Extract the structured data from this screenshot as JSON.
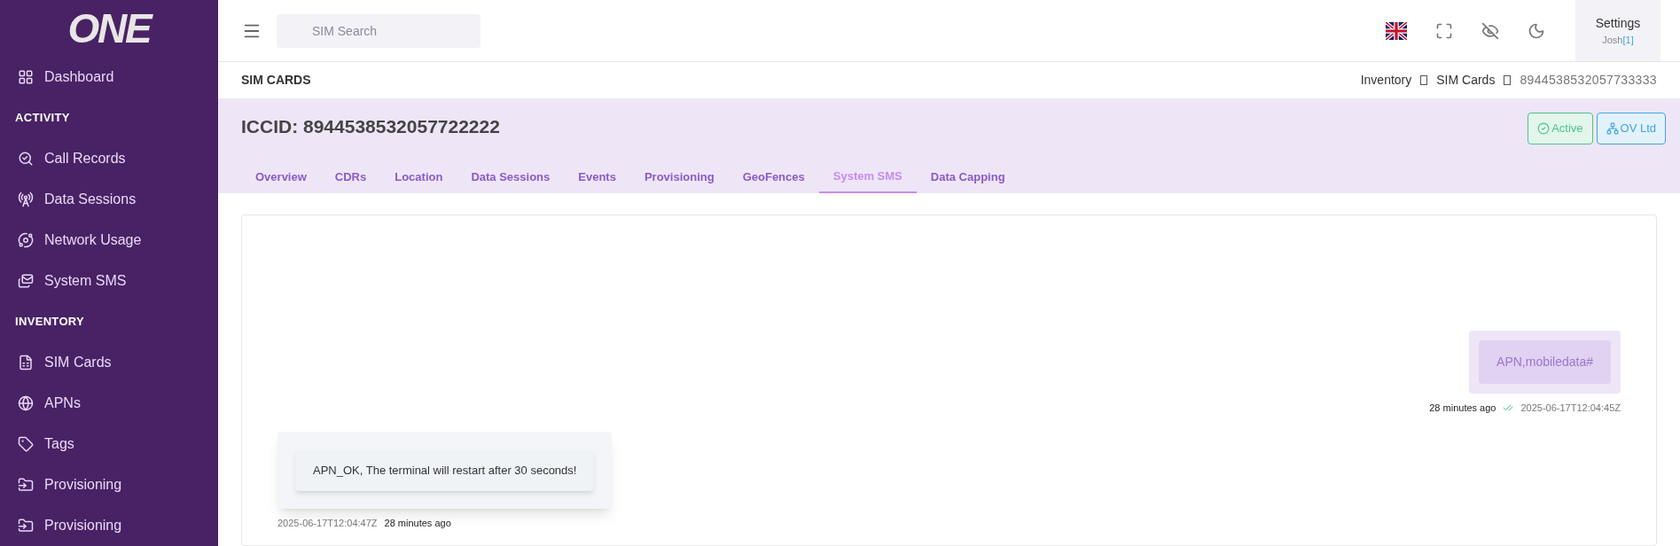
{
  "logo": "ONE",
  "sidebar": {
    "items": [
      {
        "kind": "link",
        "label": "Dashboard"
      },
      {
        "kind": "heading",
        "label": "ACTIVITY"
      },
      {
        "kind": "link",
        "label": "Call Records"
      },
      {
        "kind": "link",
        "label": "Data Sessions"
      },
      {
        "kind": "link",
        "label": "Network Usage"
      },
      {
        "kind": "link",
        "label": "System SMS"
      },
      {
        "kind": "heading",
        "label": "INVENTORY"
      },
      {
        "kind": "link",
        "label": "SIM Cards"
      },
      {
        "kind": "link",
        "label": "APNs"
      },
      {
        "kind": "link",
        "label": "Tags"
      },
      {
        "kind": "link",
        "label": "Provisioning"
      },
      {
        "kind": "link",
        "label": "Provisioning"
      }
    ]
  },
  "topbar": {
    "search": {
      "placeholder": "SIM Search"
    },
    "settings": {
      "title": "Settings",
      "user": "Josh",
      "user_suffix": "[1]"
    }
  },
  "page_title": "SIM CARDS",
  "breadcrumb": [
    {
      "label": "Inventory",
      "current": false
    },
    {
      "label": "SIM Cards",
      "current": false
    },
    {
      "label": "8944538532057733333",
      "current": true
    }
  ],
  "header": {
    "title": "ICCID: 8944538532057722222",
    "badges": [
      {
        "kind": "status",
        "label": "Active"
      },
      {
        "kind": "org",
        "label": "OV Ltd"
      }
    ]
  },
  "tabs": [
    {
      "label": "Overview",
      "selected": false
    },
    {
      "label": "CDRs",
      "selected": false
    },
    {
      "label": "Location",
      "selected": false
    },
    {
      "label": "Data Sessions",
      "selected": false
    },
    {
      "label": "Events",
      "selected": false
    },
    {
      "label": "Provisioning",
      "selected": false
    },
    {
      "label": "GeoFences",
      "selected": false
    },
    {
      "label": "System SMS",
      "selected": true
    },
    {
      "label": "Data Capping",
      "selected": false
    }
  ],
  "messages": [
    {
      "kind": "outgoing",
      "text": "APN,mobiledata#",
      "ago": "28 minutes ago",
      "delivered": true,
      "timestamp": "2025-06-17T12:04:45Z"
    },
    {
      "kind": "incoming",
      "text": "APN_OK, The terminal will restart after 30 seconds!",
      "ago": "28 minutes ago",
      "timestamp": "2025-06-17T12:04:47Z"
    }
  ]
}
